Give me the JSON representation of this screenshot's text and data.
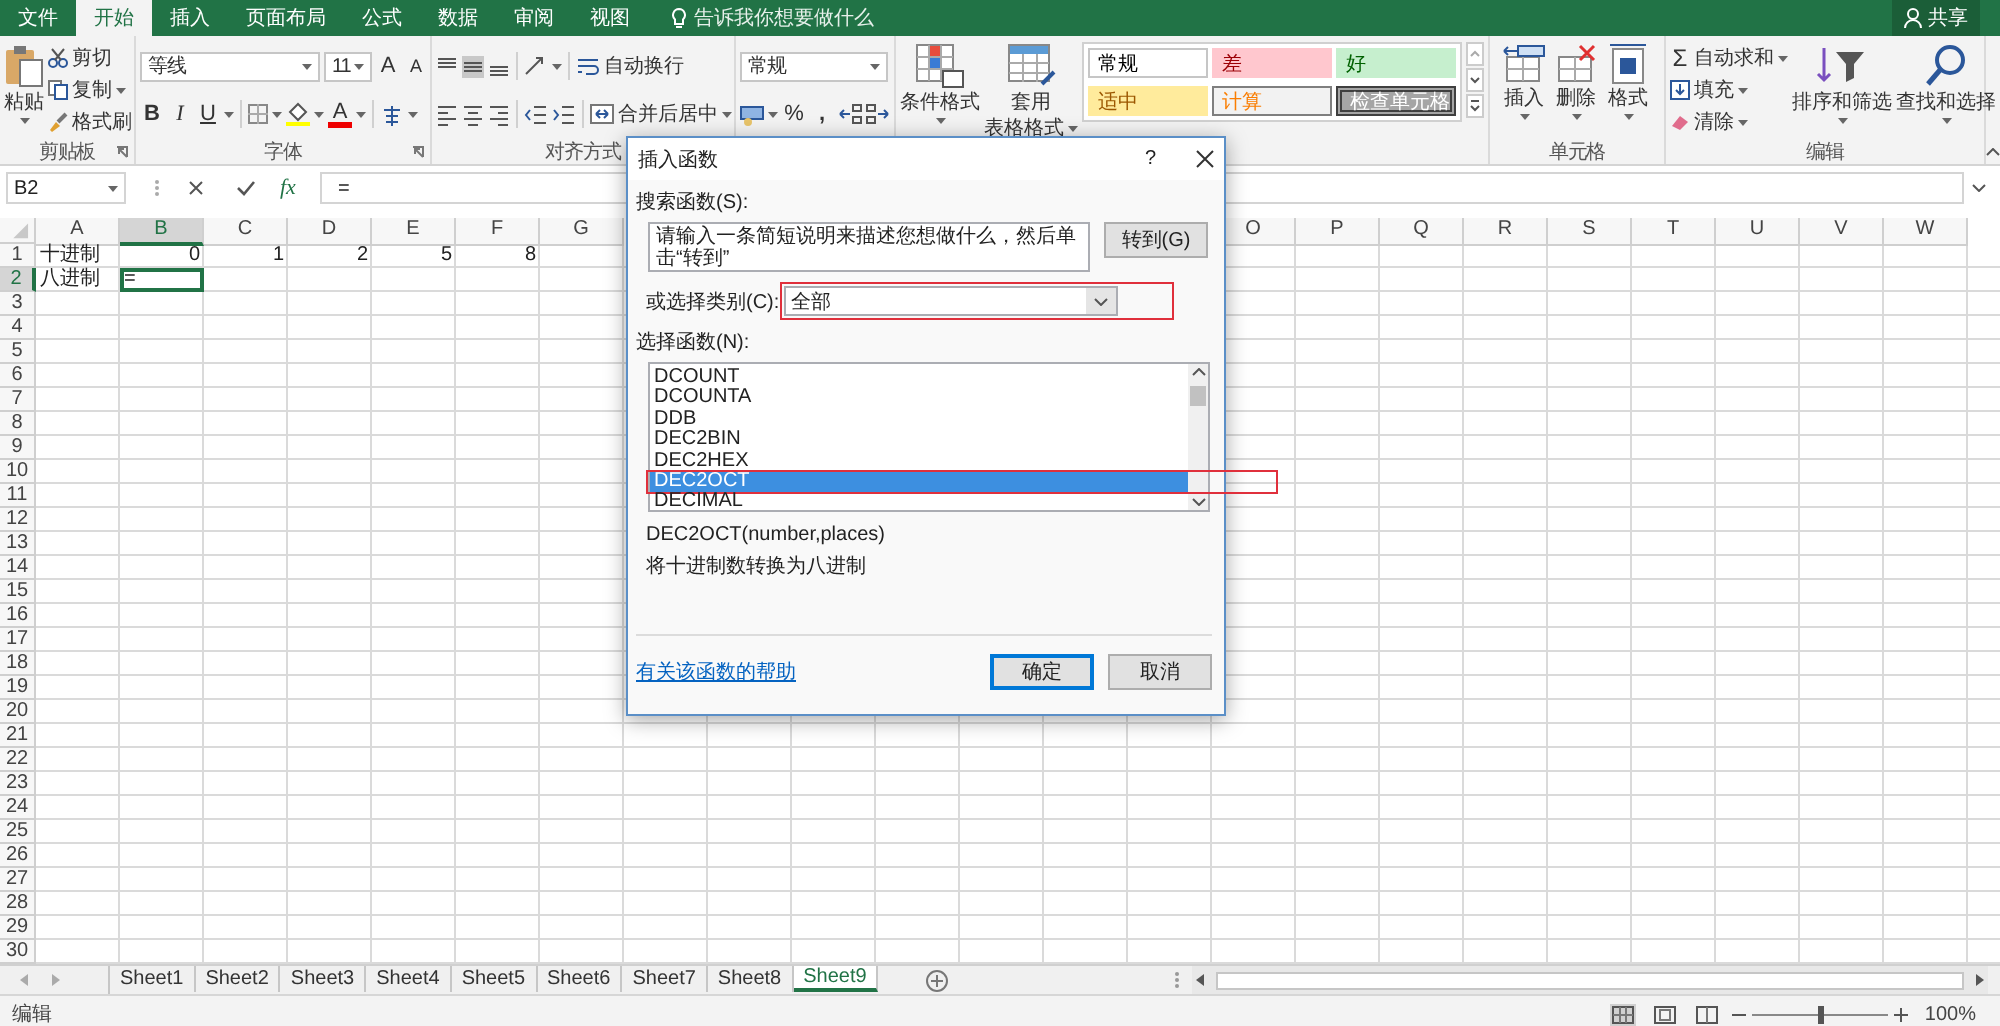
{
  "ribbon": {
    "tabs": [
      {
        "label": "文件",
        "selected": false
      },
      {
        "label": "开始",
        "selected": true
      },
      {
        "label": "插入",
        "selected": false
      },
      {
        "label": "页面布局",
        "selected": false
      },
      {
        "label": "公式",
        "selected": false
      },
      {
        "label": "数据",
        "selected": false
      },
      {
        "label": "审阅",
        "selected": false
      },
      {
        "label": "视图",
        "selected": false
      }
    ],
    "tell_me": "告诉我你想要做什么",
    "share": "共享",
    "clipboard": {
      "title": "剪贴板",
      "paste": "粘贴",
      "cut": "剪切",
      "copy": "复制",
      "format_painter": "格式刷"
    },
    "font": {
      "title": "字体",
      "font_name": "等线",
      "font_size": "11",
      "grow": "A",
      "shrink": "A",
      "bold": "B",
      "italic": "I",
      "underline": "U",
      "font_color": "A"
    },
    "alignment": {
      "title": "对齐方式",
      "vertical_buttons": [
        {
          "selected": false
        },
        {
          "selected": true
        },
        {
          "selected": false
        }
      ],
      "wrap_text": "自动换行",
      "merge_center": "合并后居中"
    },
    "number": {
      "format": "常规",
      "percent": "%",
      "comma": ","
    },
    "styles": {
      "conditional": "条件格式",
      "table_format": [
        "套用",
        "表格格式"
      ],
      "cell_styles": [
        {
          "label": "常规",
          "kind": "normal"
        },
        {
          "label": "差",
          "kind": "bad"
        },
        {
          "label": "好",
          "kind": "good"
        },
        {
          "label": "适中",
          "kind": "neutral"
        },
        {
          "label": "计算",
          "kind": "calculation"
        },
        {
          "label": "检查单元格",
          "kind": "check"
        }
      ]
    },
    "cells": {
      "title": "单元格",
      "insert": "插入",
      "delete": "删除",
      "format": "格式"
    },
    "editing": {
      "title": "编辑",
      "autosum_symbol": "Σ",
      "autosum": "自动求和",
      "fill": "填充",
      "clear": "清除",
      "sort_filter": "排序和筛选",
      "find_select": "查找和选择"
    }
  },
  "formula_bar": {
    "name_box": "B2",
    "fx": "fx",
    "formula": "="
  },
  "sheet": {
    "columns_left": [
      {
        "label": "A",
        "selected": false
      },
      {
        "label": "B",
        "selected": true
      },
      {
        "label": "C",
        "selected": false
      },
      {
        "label": "D",
        "selected": false
      },
      {
        "label": "E",
        "selected": false
      },
      {
        "label": "F",
        "selected": false
      },
      {
        "label": "G",
        "selected": false
      }
    ],
    "columns_right": [
      {
        "label": "O",
        "selected": false
      },
      {
        "label": "P",
        "selected": false
      },
      {
        "label": "Q",
        "selected": false
      },
      {
        "label": "R",
        "selected": false
      },
      {
        "label": "S",
        "selected": false
      },
      {
        "label": "T",
        "selected": false
      },
      {
        "label": "U",
        "selected": false
      },
      {
        "label": "V",
        "selected": false
      },
      {
        "label": "W",
        "selected": false
      }
    ],
    "rows": [
      {
        "number": "1",
        "selected": false,
        "cells": [
          {
            "text": "十进制",
            "kind": "text",
            "selected": false
          },
          {
            "text": "0",
            "kind": "number",
            "selected": false
          },
          {
            "text": "1",
            "kind": "number",
            "selected": false
          },
          {
            "text": "2",
            "kind": "number",
            "selected": false
          },
          {
            "text": "5",
            "kind": "number",
            "selected": false
          },
          {
            "text": "8",
            "kind": "number",
            "selected": false
          }
        ]
      },
      {
        "number": "2",
        "selected": true,
        "cells": [
          {
            "text": "八进制",
            "kind": "text",
            "selected": false
          },
          {
            "text": "=",
            "kind": "text",
            "selected": true
          }
        ]
      },
      {
        "number": "3"
      },
      {
        "number": "4"
      },
      {
        "number": "5"
      },
      {
        "number": "6"
      },
      {
        "number": "7"
      },
      {
        "number": "8"
      },
      {
        "number": "9"
      },
      {
        "number": "10"
      },
      {
        "number": "11"
      },
      {
        "number": "12"
      },
      {
        "number": "13"
      },
      {
        "number": "14"
      },
      {
        "number": "15"
      },
      {
        "number": "16"
      },
      {
        "number": "17"
      },
      {
        "number": "18"
      },
      {
        "number": "19"
      },
      {
        "number": "20"
      },
      {
        "number": "21"
      },
      {
        "number": "22"
      },
      {
        "number": "23"
      },
      {
        "number": "24"
      },
      {
        "number": "25"
      },
      {
        "number": "26"
      },
      {
        "number": "27"
      },
      {
        "number": "28"
      },
      {
        "number": "29"
      },
      {
        "number": "30"
      }
    ]
  },
  "sheet_tabs": [
    {
      "label": "Sheet1",
      "selected": false
    },
    {
      "label": "Sheet2",
      "selected": false
    },
    {
      "label": "Sheet3",
      "selected": false
    },
    {
      "label": "Sheet4",
      "selected": false
    },
    {
      "label": "Sheet5",
      "selected": false
    },
    {
      "label": "Sheet6",
      "selected": false
    },
    {
      "label": "Sheet7",
      "selected": false
    },
    {
      "label": "Sheet8",
      "selected": false
    },
    {
      "label": "Sheet9",
      "selected": true
    }
  ],
  "status_bar": {
    "mode": "编辑",
    "views": [
      {
        "selected": true
      },
      {
        "selected": false
      },
      {
        "selected": false
      }
    ],
    "zoom": {
      "level": 0.5,
      "reading": "100%"
    }
  },
  "dialog": {
    "title": "插入函数",
    "help": "?",
    "search_label": "搜索函数(S):",
    "search_value": "请输入一条简短说明来描述您想做什么，然后单击“转到”",
    "go_button": "转到(G)",
    "category_label": "或选择类别(C):",
    "category_value": "全部",
    "category_highlighted": true,
    "list_label": "选择函数(N):",
    "functions": [
      {
        "name": "DCOUNT",
        "selected": false,
        "highlighted": false
      },
      {
        "name": "DCOUNTA",
        "selected": false,
        "highlighted": false
      },
      {
        "name": "DDB",
        "selected": false,
        "highlighted": false
      },
      {
        "name": "DEC2BIN",
        "selected": false,
        "highlighted": false
      },
      {
        "name": "DEC2HEX",
        "selected": false,
        "highlighted": false
      },
      {
        "name": "DEC2OCT",
        "selected": true,
        "highlighted": true
      },
      {
        "name": "DECIMAL",
        "selected": false,
        "highlighted": false
      }
    ],
    "signature": "DEC2OCT(number,places)",
    "description": "将十进制数转换为八进制",
    "help_link": "有关该函数的帮助",
    "buttons": [
      {
        "label": "确定",
        "default": true
      },
      {
        "label": "取消",
        "default": false
      }
    ]
  }
}
